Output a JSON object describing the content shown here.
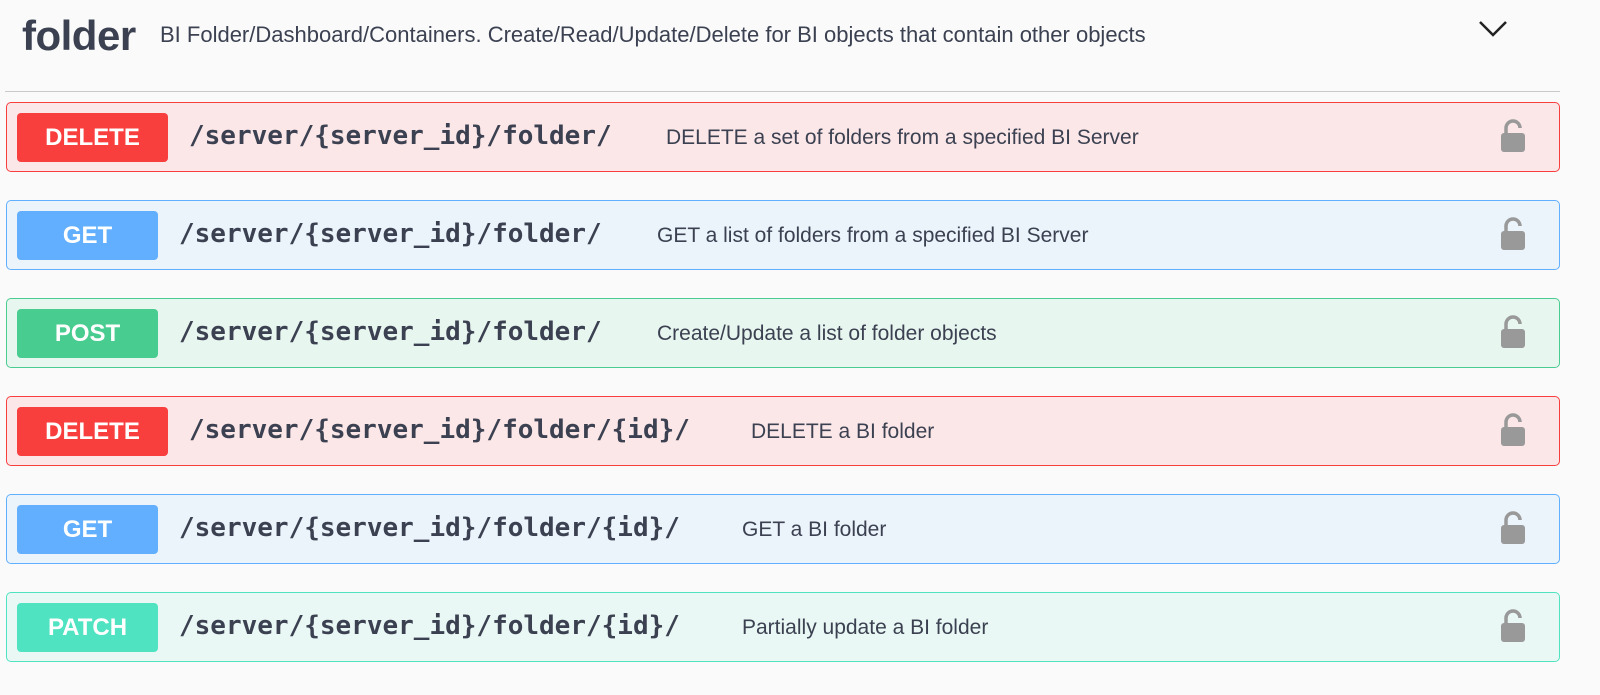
{
  "section": {
    "name": "folder",
    "description": "BI Folder/Dashboard/Containers. Create/Read/Update/Delete for BI objects that contain other objects",
    "toggle_icon": "chevron-down-icon"
  },
  "operations": [
    {
      "method": "DELETE",
      "path": "/server/{server_id}/folder/",
      "summary": "DELETE a set of folders from a specified BI Server",
      "lock_icon": "lock-open-icon"
    },
    {
      "method": "GET",
      "path": "/server/{server_id}/folder/",
      "summary": "GET a list of folders from a specified BI Server",
      "lock_icon": "lock-open-icon"
    },
    {
      "method": "POST",
      "path": "/server/{server_id}/folder/",
      "summary": "Create/Update a list of folder objects",
      "lock_icon": "lock-open-icon"
    },
    {
      "method": "DELETE",
      "path": "/server/{server_id}/folder/{id}/",
      "summary": "DELETE a BI folder",
      "lock_icon": "lock-open-icon"
    },
    {
      "method": "GET",
      "path": "/server/{server_id}/folder/{id}/",
      "summary": "GET a BI folder",
      "lock_icon": "lock-open-icon"
    },
    {
      "method": "PATCH",
      "path": "/server/{server_id}/folder/{id}/",
      "summary": "Partially update a BI folder",
      "lock_icon": "lock-open-icon"
    }
  ],
  "colors": {
    "delete": "#f93e3e",
    "get": "#61affe",
    "post": "#49cc90",
    "patch": "#50e3c2",
    "text": "#3b4151",
    "lock": "#999999"
  }
}
